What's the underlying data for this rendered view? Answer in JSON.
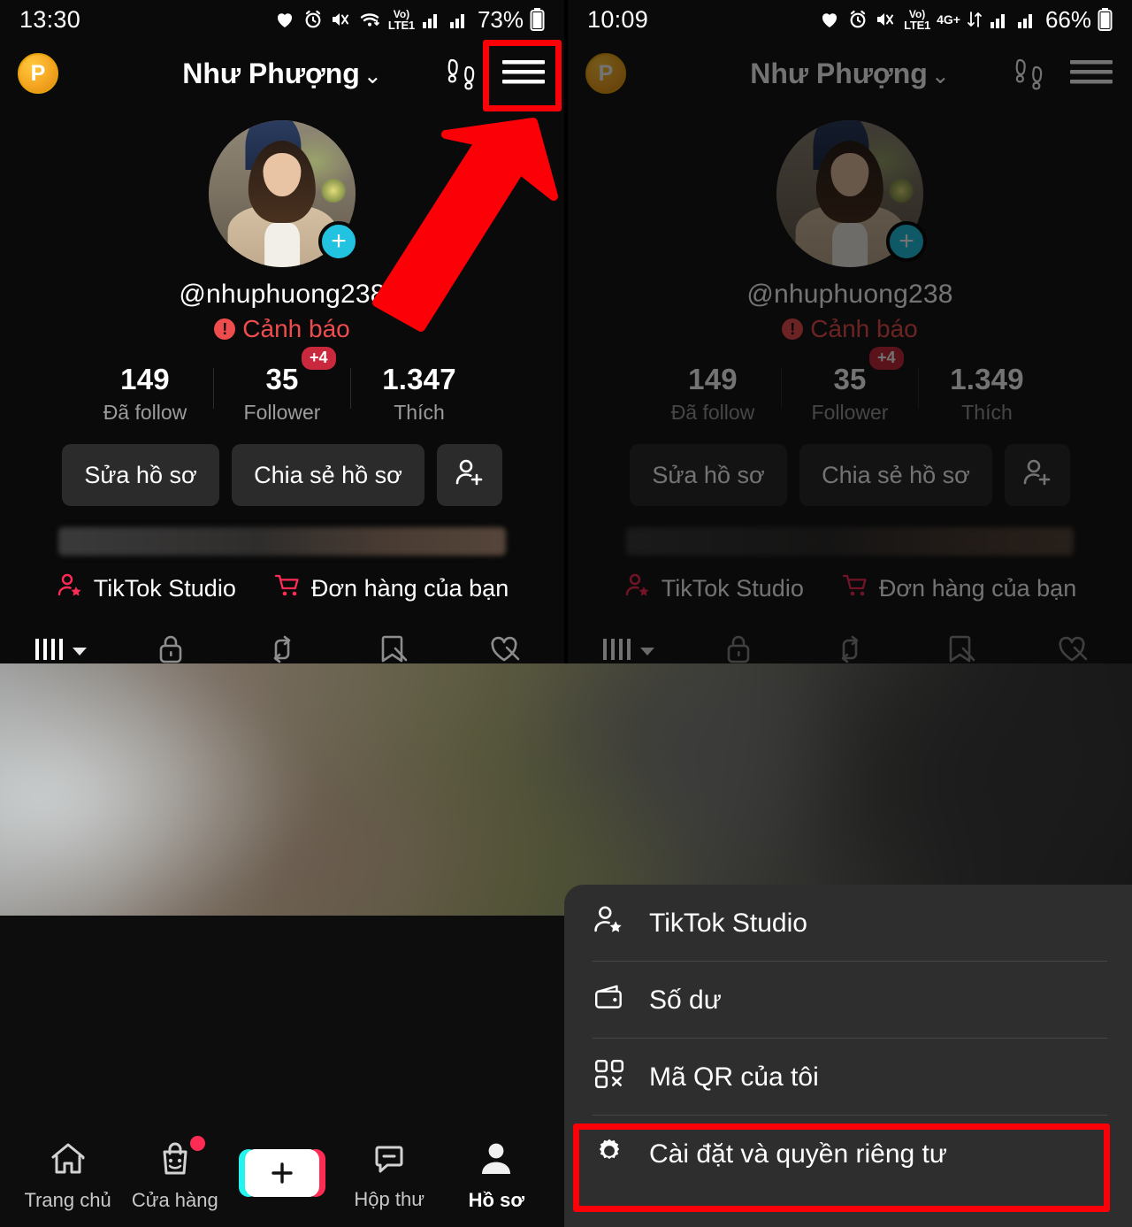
{
  "left_panel": {
    "status_bar": {
      "time": "13:30",
      "battery": "73%",
      "network_label_top": "Vo)",
      "network_label_bottom": "LTE1",
      "icons": [
        "heart-icon",
        "alarm-icon",
        "mute-vibrate-icon",
        "wifi-icon",
        "volte-icon",
        "signal-icon-1",
        "signal-icon-2",
        "battery-icon"
      ]
    },
    "app_bar": {
      "coin_letter": "P",
      "title": "Như Phượng",
      "chevron": "⌄",
      "footsteps_icon": "footsteps-icon",
      "hamburger_icon": "hamburger-icon"
    },
    "profile": {
      "handle": "@nhuphuong238",
      "warning_icon": "!",
      "warning_label": "Cảnh báo",
      "plus_badge": "+"
    },
    "stats": [
      {
        "value": "149",
        "label": "Đã follow",
        "badge": ""
      },
      {
        "value": "35",
        "label": "Follower",
        "badge": "+4"
      },
      {
        "value": "1.347",
        "label": "Thích",
        "badge": ""
      }
    ],
    "actions": {
      "edit_profile": "Sửa hồ sơ",
      "share_profile": "Chia sẻ hồ sơ",
      "add_user_icon": "add-user-icon"
    },
    "shortcuts": [
      {
        "icon": "studio-icon",
        "label": "TikTok Studio"
      },
      {
        "icon": "cart-icon",
        "label": "Đơn hàng của bạn"
      }
    ],
    "tabs": [
      {
        "icon": "grid-posts-icon",
        "active": true
      },
      {
        "icon": "lock-private-icon",
        "active": false
      },
      {
        "icon": "repost-icon",
        "active": false
      },
      {
        "icon": "saved-hidden-icon",
        "active": false
      },
      {
        "icon": "liked-hidden-icon",
        "active": false
      }
    ]
  },
  "right_panel": {
    "status_bar": {
      "time": "10:09",
      "battery": "66%",
      "network_label_top": "Vo)",
      "network_label_bottom": "LTE1",
      "generation": "4G+"
    },
    "app_bar": {
      "coin_letter": "P",
      "title": "Như Phượng",
      "chevron": "⌄"
    },
    "profile": {
      "handle": "@nhuphuong238",
      "warning_icon": "!",
      "warning_label": "Cảnh báo",
      "plus_badge": "+"
    },
    "stats": [
      {
        "value": "149",
        "label": "Đã follow",
        "badge": ""
      },
      {
        "value": "35",
        "label": "Follower",
        "badge": "+4"
      },
      {
        "value": "1.349",
        "label": "Thích",
        "badge": ""
      }
    ],
    "actions": {
      "edit_profile": "Sửa hồ sơ",
      "share_profile": "Chia sẻ hồ sơ",
      "add_user_icon": "add-user-icon"
    },
    "shortcuts": [
      {
        "icon": "studio-icon",
        "label": "TikTok Studio"
      },
      {
        "icon": "cart-icon",
        "label": "Đơn hàng của bạn"
      }
    ]
  },
  "bottom_nav": [
    {
      "icon": "home-icon",
      "label": "Trang chủ",
      "active": false,
      "dot": false
    },
    {
      "icon": "shop-icon",
      "label": "Cửa hàng",
      "active": false,
      "dot": true
    },
    {
      "icon": "create-icon",
      "label": "",
      "active": false,
      "dot": false
    },
    {
      "icon": "inbox-icon",
      "label": "Hộp thư",
      "active": false,
      "dot": false
    },
    {
      "icon": "profile-icon",
      "label": "Hồ sơ",
      "active": true,
      "dot": false
    }
  ],
  "menu_sheet": {
    "items": [
      {
        "icon": "studio-icon",
        "label": "TikTok Studio",
        "highlighted": false
      },
      {
        "icon": "wallet-icon",
        "label": "Số dư",
        "highlighted": false
      },
      {
        "icon": "qr-code-icon",
        "label": "Mã QR của tôi",
        "highlighted": false
      },
      {
        "icon": "gear-icon",
        "label": "Cài đặt và quyền riêng tư",
        "highlighted": true
      }
    ]
  },
  "annotations": {
    "arrow": "red-arrow-up-right",
    "highlight_hamburger": "red-box-hamburger",
    "highlight_settings": "red-box-settings"
  },
  "colors": {
    "accent_red": "#fb0007",
    "tiktok_pink": "#fe2c55",
    "tiktok_cyan": "#25f4ee",
    "coin_gold": "#f5a623",
    "plus_badge": "#22c3e0",
    "warning": "#ef4d4d",
    "panel_bg": "#0a0a0a",
    "sheet_bg": "#2e2e2e"
  }
}
